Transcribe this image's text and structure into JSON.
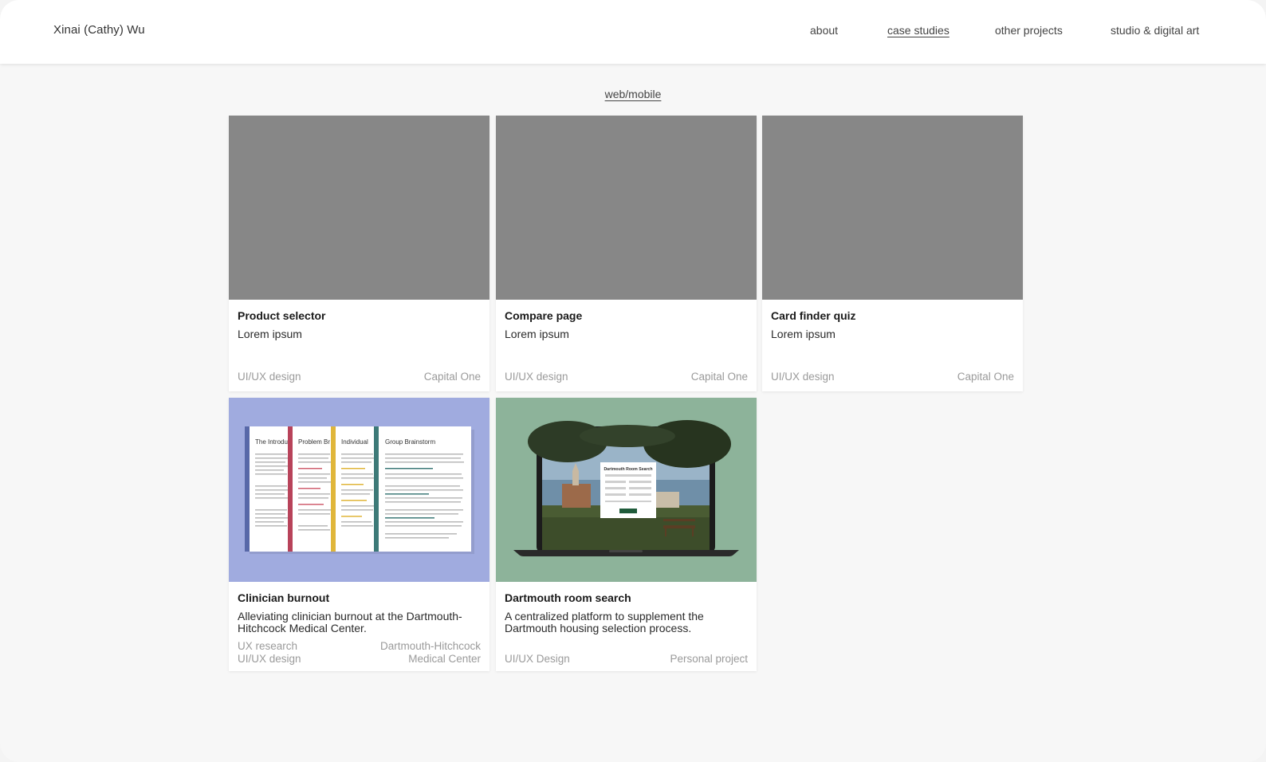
{
  "header": {
    "brand": "Xinai (Cathy) Wu",
    "nav": [
      "about",
      "case studies",
      "other projects",
      "studio & digital art"
    ],
    "active_nav": "case studies"
  },
  "section": {
    "title": "web/mobile"
  },
  "cards": [
    {
      "title": "Product selector",
      "desc": "Lorem ipsum",
      "tags_left": [
        "UI/UX design"
      ],
      "tags_right": [
        "Capital One"
      ],
      "thumb_color": "#878787"
    },
    {
      "title": "Compare page",
      "desc": "Lorem ipsum",
      "tags_left": [
        "UI/UX design"
      ],
      "tags_right": [
        "Capital One"
      ],
      "thumb_color": "#878787"
    },
    {
      "title": "Card finder quiz",
      "desc": "Lorem ipsum",
      "tags_left": [
        "UI/UX design"
      ],
      "tags_right": [
        "Capital One"
      ],
      "thumb_color": "#878787"
    },
    {
      "title": "Clinician burnout",
      "desc": "Alleviating clinician burnout at the Dartmouth-Hitchcock Medical Center.",
      "tags_left": [
        "UX research",
        "UI/UX design"
      ],
      "tags_right": [
        "Dartmouth-Hitchcock",
        "Medical Center"
      ],
      "thumb_color": "#a0abdf",
      "thumb_pages": [
        "The Introdu",
        "Problem Br",
        "Individual",
        "Group Brainstorm"
      ]
    },
    {
      "title": "Dartmouth room search",
      "desc": "A centralized platform to supplement the Dartmouth housing selection process.",
      "tags_left": [
        "UI/UX Design"
      ],
      "tags_right": [
        "Personal project"
      ],
      "thumb_color": "#8db39a",
      "thumb_screen_title": "Dartmouth Room Search"
    }
  ],
  "colors": {
    "page_bg": "#f7f7f7",
    "card_bg": "#ffffff",
    "placeholder": "#878787",
    "periwinkle": "#a0abdf",
    "sage": "#8db39a"
  }
}
